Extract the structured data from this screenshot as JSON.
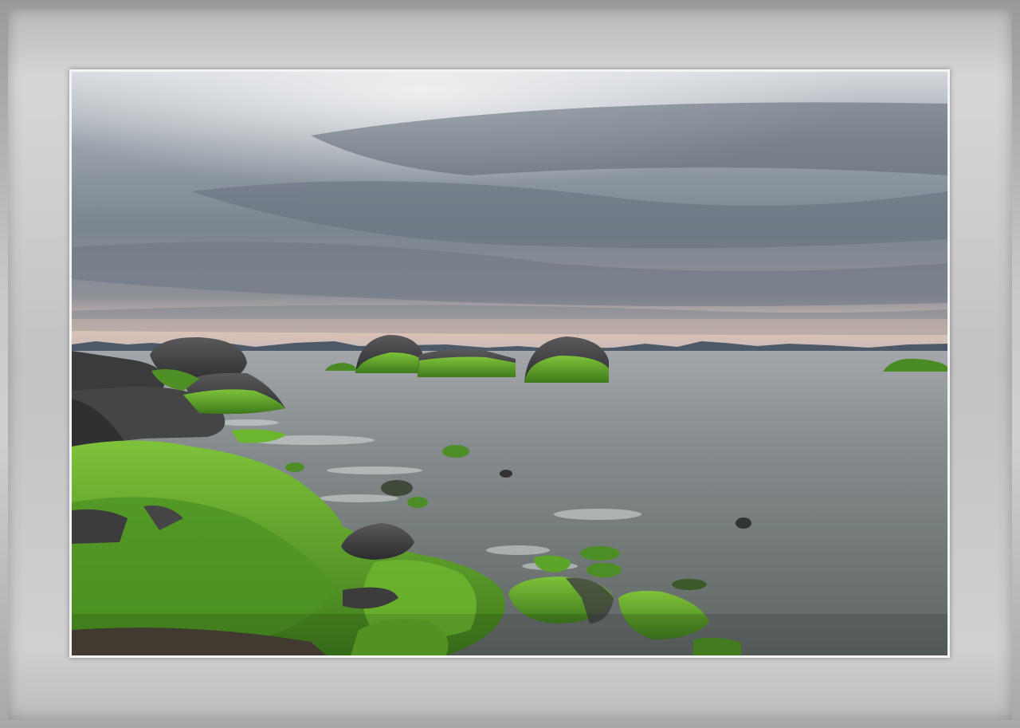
{
  "image": {
    "subject": "seascape-with-mossy-rocks",
    "colors": {
      "frame": "#9a9a9a",
      "mat": "#c9c9c9",
      "sky_light": "#e8ebee",
      "sky_dark": "#6b7480",
      "horizon_glow": "#e6c9b8",
      "sea": "#7d8587",
      "moss": "#5aa12a",
      "rock": "#3e3e40"
    }
  }
}
